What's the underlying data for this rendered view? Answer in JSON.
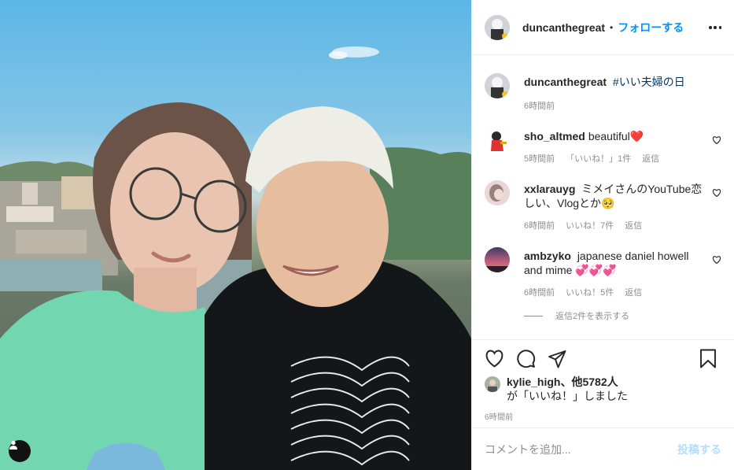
{
  "post": {
    "author": "duncanthegreat",
    "follow_label": "フォローする",
    "dot": "•",
    "caption_author": "duncanthegreat",
    "caption_hashtag": "#いい夫婦の日",
    "caption_time": "6時間前"
  },
  "comments": [
    {
      "user": "sho_altmed",
      "text": "beautiful❤️",
      "time": "5時間前",
      "likes": "「いいね！」1件",
      "reply": "返信"
    },
    {
      "user": "xxlarauyg",
      "text": "ミメイさんのYouTube恋しい、Vlogとか🥺",
      "time": "6時間前",
      "likes": "いいね！7件",
      "reply": "返信"
    },
    {
      "user": "ambzyko",
      "text": "japanese daniel howell and mime 💞💞💞",
      "time": "6時間前",
      "likes": "いいね！5件",
      "reply": "返信"
    }
  ],
  "view_replies": "返信2件を表示する",
  "likes_summary": {
    "user": "kylie_high",
    "rest": "、他5782人",
    "line2": "が「いいね！」しました"
  },
  "timestamp": "6時間前",
  "comment_box": {
    "placeholder": "コメントを追加...",
    "post_label": "投稿する"
  },
  "icons": [
    "heart-icon",
    "comment-icon",
    "share-icon",
    "bookmark-icon",
    "more-options-icon",
    "user-tag-icon"
  ],
  "colors": {
    "accent": "#0095f6",
    "post_disabled": "#b2dffc",
    "text": "#262626",
    "muted": "#8e8e8e",
    "heart": "#ed4956"
  }
}
